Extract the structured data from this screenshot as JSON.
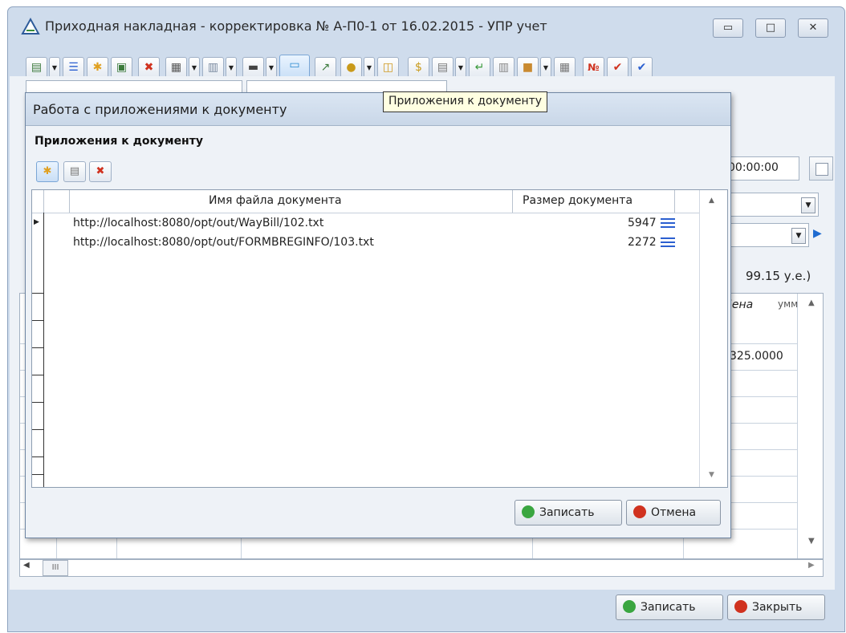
{
  "window": {
    "title": "Приходная накладная - корректировка № А-П0-1 от 16.02.2015 - УПР учет",
    "controls": {
      "minimize": "▭",
      "maximize": "□",
      "close": "✕"
    }
  },
  "tooltip": "Приложения к документу",
  "main": {
    "time_value": "00:00:00",
    "total_text": "99.15 у.е.)",
    "column_price": "Цена",
    "column_sum": "умм",
    "row_price": "325.0000",
    "hscroll_thumb": "III"
  },
  "footer": {
    "save_label": "Записать",
    "close_label": "Закрыть"
  },
  "dialog": {
    "title": "Работа с приложениями к документу",
    "subtitle": "Приложения к документу",
    "columns": {
      "file": "Имя файла документа",
      "size": "Размер документа"
    },
    "rows": [
      {
        "file": "http://localhost:8080/opt/out/WayBill/102.txt",
        "size": "5947"
      },
      {
        "file": "http://localhost:8080/opt/out/FORMBREGINFO/103.txt",
        "size": "2272"
      }
    ],
    "save_label": "Записать",
    "cancel_label": "Отмена"
  },
  "colors": {
    "accent_blue": "#2b5fd0",
    "green_ok": "#3aa640",
    "red_cancel": "#d0321f"
  }
}
